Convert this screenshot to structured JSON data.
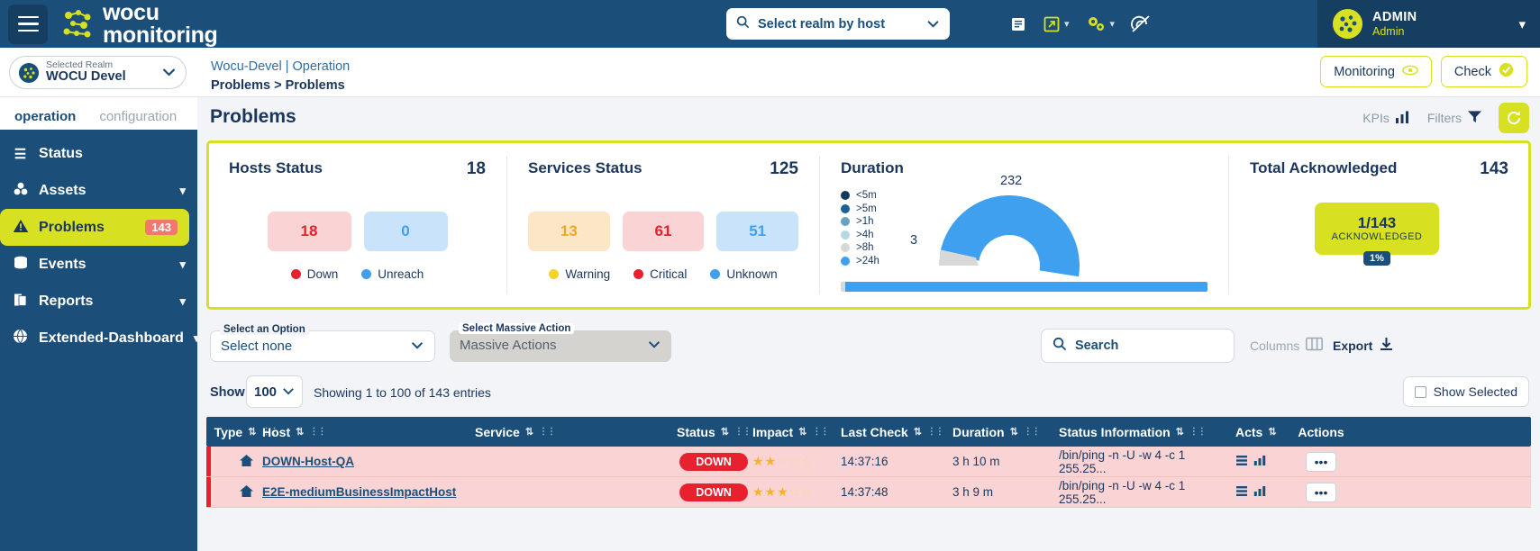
{
  "header": {
    "menu_icon": "hamburger-icon",
    "brand_line1": "wocu",
    "brand_line2": "monitoring",
    "realm_search_placeholder": "Select realm by host",
    "search_icon": "search-icon",
    "chevron_icon": "chevron-down-icon",
    "icons": [
      {
        "name": "book-icon",
        "glyph": "☰"
      },
      {
        "name": "external-link-icon",
        "glyph": "↗"
      },
      {
        "name": "gears-icon",
        "glyph": "⚙"
      },
      {
        "name": "radar-off-icon",
        "glyph": "⌀"
      }
    ],
    "user_name": "ADMIN",
    "user_role": "Admin"
  },
  "subbar": {
    "realm_label": "Selected Realm",
    "realm_value": "WOCU Devel",
    "breadcrumb_top": "Wocu-Devel | Operation",
    "breadcrumb_bottom": "Problems > Problems",
    "monitoring_btn": "Monitoring",
    "check_btn": "Check"
  },
  "sidebar": {
    "tabs": [
      {
        "label": "operation",
        "active": true
      },
      {
        "label": "configuration",
        "active": false
      }
    ],
    "items": [
      {
        "label": "Status",
        "icon": "list-icon",
        "glyph": "☰",
        "caret": false,
        "badge": null,
        "active": false
      },
      {
        "label": "Assets",
        "icon": "assets-icon",
        "glyph": "☸",
        "caret": true,
        "badge": null,
        "active": false
      },
      {
        "label": "Problems",
        "icon": "warning-triangle-icon",
        "glyph": "⚠",
        "caret": false,
        "badge": "143",
        "active": true
      },
      {
        "label": "Events",
        "icon": "database-icon",
        "glyph": "☷",
        "caret": true,
        "badge": null,
        "active": false
      },
      {
        "label": "Reports",
        "icon": "documents-icon",
        "glyph": "▤",
        "caret": true,
        "badge": null,
        "active": false
      },
      {
        "label": "Extended-Dashboard",
        "icon": "globe-icon",
        "glyph": "⊕",
        "caret": true,
        "badge": null,
        "active": false
      }
    ]
  },
  "page": {
    "title": "Problems",
    "kpis_label": "KPIs",
    "filters_label": "Filters",
    "refresh_icon": "refresh-icon"
  },
  "cards": {
    "hosts": {
      "title": "Hosts Status",
      "total": "18",
      "stats": [
        {
          "value": "18",
          "label": "Down",
          "bg": "#fad4d4",
          "fg": "#e8212e",
          "dot": "#e8212e"
        },
        {
          "value": "0",
          "label": "Unreach",
          "bg": "#c9e4fa",
          "fg": "#3fa0f0",
          "dot": "#3fa0f0"
        }
      ]
    },
    "services": {
      "title": "Services Status",
      "total": "125",
      "stats": [
        {
          "value": "13",
          "label": "Warning",
          "bg": "#fbe7c6",
          "fg": "#f0a623",
          "dot": "#f5d32b"
        },
        {
          "value": "61",
          "label": "Critical",
          "bg": "#fad4d4",
          "fg": "#e8212e",
          "dot": "#e8212e"
        },
        {
          "value": "51",
          "label": "Unknown",
          "bg": "#c9e4fa",
          "fg": "#3fa0f0",
          "dot": "#3fa0f0"
        }
      ]
    },
    "duration": {
      "title": "Duration",
      "label_left": "3",
      "label_top": "232"
    },
    "acknowledged": {
      "title": "Total Acknowledged",
      "total": "143",
      "value": "1/143",
      "sublabel": "ACKNOWLEDGED",
      "percent": "1%"
    }
  },
  "chart_data": [
    {
      "type": "pie",
      "title": "Duration",
      "legend_position": "left",
      "categories": [
        "<5m",
        ">5m",
        ">1h",
        ">4h",
        ">8h",
        ">24h"
      ],
      "colors": [
        "#123a5c",
        "#1b5f96",
        "#6aa2c4",
        "#b9d6e6",
        "#d8d8d8",
        "#3fa0f0"
      ],
      "values": [
        0,
        0,
        0,
        0,
        3,
        232
      ],
      "labels": [
        "3",
        "232"
      ],
      "annotations": [
        "3",
        "232"
      ]
    },
    {
      "type": "bar",
      "title": "Duration distribution bar",
      "categories": [
        ">8h",
        ">24h"
      ],
      "values": [
        3,
        232
      ],
      "colors": [
        "#d8d8d8",
        "#3fa0f0"
      ],
      "grid": false
    },
    {
      "type": "bar",
      "title": "Hosts Status",
      "categories": [
        "Down",
        "Unreach"
      ],
      "values": [
        18,
        0
      ],
      "ylabel": "",
      "xlabel": ""
    },
    {
      "type": "bar",
      "title": "Services Status",
      "categories": [
        "Warning",
        "Critical",
        "Unknown"
      ],
      "values": [
        13,
        61,
        51
      ],
      "ylabel": "",
      "xlabel": ""
    }
  ],
  "controls": {
    "select_option_label": "Select an Option",
    "select_option_value": "Select none",
    "massive_label": "Select Massive Action",
    "massive_value": "Massive Actions",
    "search_placeholder": "Search",
    "columns_label": "Columns",
    "export_label": "Export"
  },
  "showrow": {
    "show_label": "Show",
    "page_size": "100",
    "entries_prefix": "Showing ",
    "entries_text": "Showing 1 to 100 of 143 entries",
    "show_selected_label": "Show Selected"
  },
  "table": {
    "columns": [
      {
        "label": "Type",
        "cls": "c-type"
      },
      {
        "label": "Host",
        "cls": "c-host"
      },
      {
        "label": "Service",
        "cls": "c-serv"
      },
      {
        "label": "Status",
        "cls": "c-stat"
      },
      {
        "label": "Impact",
        "cls": "c-imp"
      },
      {
        "label": "Last Check",
        "cls": "c-last"
      },
      {
        "label": "Duration",
        "cls": "c-dur"
      },
      {
        "label": "Status Information",
        "cls": "c-info"
      },
      {
        "label": "Acts",
        "cls": "c-acts"
      },
      {
        "label": "Actions",
        "cls": "c-actions"
      }
    ],
    "rows": [
      {
        "type_icon": "host-icon",
        "host": "DOWN-Host-QA",
        "service": "",
        "status": "DOWN",
        "impact": 2,
        "impact_max": 5,
        "last_check": "14:37:16",
        "duration": "3 h 10 m",
        "status_information": "/bin/ping -n -U -w 4 -c 1 255.25...",
        "acts": [
          "list-icon",
          "chart-icon"
        ],
        "actions": "•••"
      },
      {
        "type_icon": "host-icon",
        "host": "E2E-mediumBusinessImpactHost",
        "service": "",
        "status": "DOWN",
        "impact": 3,
        "impact_max": 5,
        "last_check": "14:37:48",
        "duration": "3 h 9 m",
        "status_information": "/bin/ping -n -U -w 4 -c 1 255.25...",
        "acts": [
          "list-icon",
          "chart-icon"
        ],
        "actions": "•••"
      }
    ]
  },
  "colors": {
    "brand_blue": "#1b4f79",
    "brand_lime": "#d7e021",
    "danger": "#e8212e",
    "info": "#3fa0f0",
    "warning": "#f5d32b"
  }
}
